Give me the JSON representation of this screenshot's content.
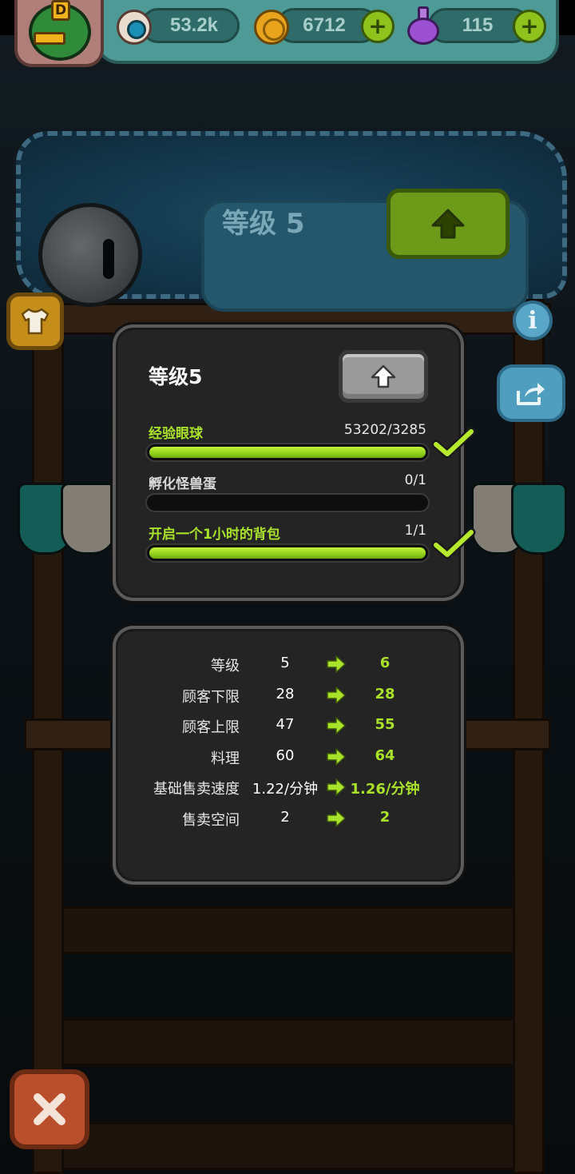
{
  "hud": {
    "rank_letter": "D",
    "eyeballs": "53.2k",
    "coins": "6712",
    "potions": "115",
    "plus_symbol": "+"
  },
  "banner": {
    "level_text": "等级 5"
  },
  "dialog": {
    "title": "等级5",
    "requirements": [
      {
        "label": "经验眼球",
        "value": "53202/3285",
        "progress": 1.0,
        "complete": true,
        "label_color": "#a9e22a"
      },
      {
        "label": "孵化怪兽蛋",
        "value": "0/1",
        "progress": 0.0,
        "complete": false,
        "label_color": "#d9d9d9"
      },
      {
        "label": "开启一个1小时的背包",
        "value": "1/1",
        "progress": 1.0,
        "complete": true,
        "label_color": "#a9e22a"
      }
    ]
  },
  "stats": [
    {
      "label": "等级",
      "current": "5",
      "next": "6"
    },
    {
      "label": "顾客下限",
      "current": "28",
      "next": "28"
    },
    {
      "label": "顾客上限",
      "current": "47",
      "next": "55"
    },
    {
      "label": "料理",
      "current": "60",
      "next": "64"
    },
    {
      "label": "基础售卖速度",
      "current": "1.22/分钟",
      "next": "1.26/分钟"
    },
    {
      "label": "售卖空间",
      "current": "2",
      "next": "2"
    }
  ],
  "icons": {
    "upgrade": "up-arrow-icon",
    "check": "checkmark-icon",
    "arrow": "right-arrow-icon",
    "close": "close-icon",
    "info": "info-icon",
    "share": "share-icon",
    "shirt": "shirt-icon"
  },
  "colors": {
    "accent_green": "#a9e22a",
    "panel_bg": "#242424"
  }
}
